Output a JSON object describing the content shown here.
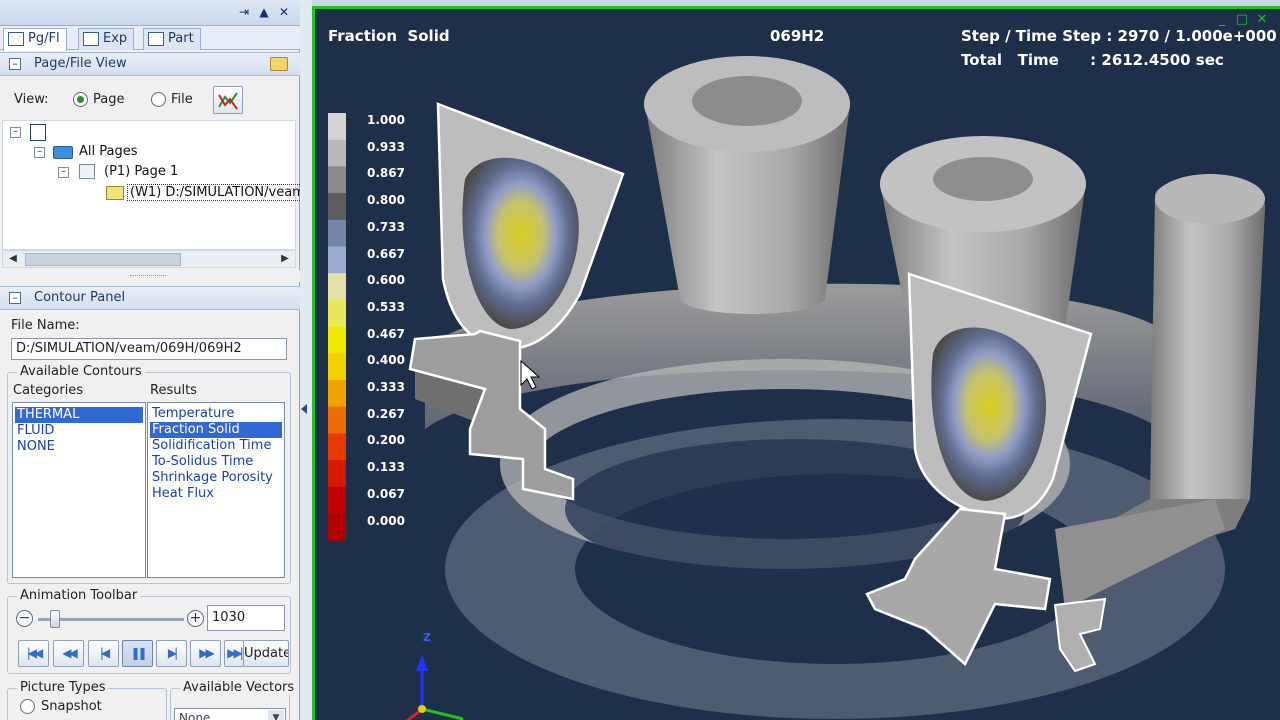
{
  "tabs": [
    {
      "label": "Pg/Fl",
      "active": true
    },
    {
      "label": "Exp",
      "active": false
    },
    {
      "label": "Part",
      "active": false
    }
  ],
  "page_file_view": {
    "title": "Page/File View",
    "view_label": "View:",
    "view_options": [
      "Page",
      "File"
    ],
    "selected_view": "Page"
  },
  "tree": {
    "all_pages": "All Pages",
    "page": "(P1) Page 1",
    "window": "(W1) D:/SIMULATION/veam"
  },
  "contour_panel": {
    "title": "Contour Panel",
    "file_name_label": "File Name:",
    "file_name": "D:/SIMULATION/veam/069H/069H2",
    "available_contours": "Available Contours",
    "categories_label": "Categories",
    "results_label": "Results",
    "categories": [
      "THERMAL",
      "FLUID",
      "NONE"
    ],
    "selected_category": "THERMAL",
    "results": [
      "Temperature",
      "Fraction Solid",
      "Solidification Time",
      "To-Solidus Time",
      "Shrinkage Porosity",
      "Heat Flux"
    ],
    "selected_result": "Fraction Solid"
  },
  "animation": {
    "title": "Animation Toolbar",
    "frame": "1030",
    "update_label": "Update"
  },
  "picture_types": {
    "title": "Picture Types",
    "option": "Snapshot"
  },
  "available_vectors": {
    "title": "Available Vectors",
    "selected": "None"
  },
  "viewport": {
    "result_title": "Fraction  Solid",
    "model_name": "069H2",
    "step_line": "Step / Time Step : 2970 / 1.000e+000",
    "time_line": "Total   Time      : 2612.4500 sec",
    "axis_z": "Z",
    "border_color": "#1fc31f",
    "background": "#1e2f4a"
  },
  "legend": {
    "values": [
      "1.000",
      "0.933",
      "0.867",
      "0.800",
      "0.733",
      "0.667",
      "0.600",
      "0.533",
      "0.467",
      "0.400",
      "0.333",
      "0.267",
      "0.200",
      "0.133",
      "0.067",
      "0.000"
    ],
    "colors": [
      "#d4d4d4",
      "#b9b9b9",
      "#8a8a8a",
      "#5d5d5d",
      "#7585a8",
      "#9aacd0",
      "#e6e1a9",
      "#ece65a",
      "#f0ea00",
      "#f3d200",
      "#f1a300",
      "#ee6d00",
      "#e83a00",
      "#d81800",
      "#c20000",
      "#b10000"
    ]
  }
}
